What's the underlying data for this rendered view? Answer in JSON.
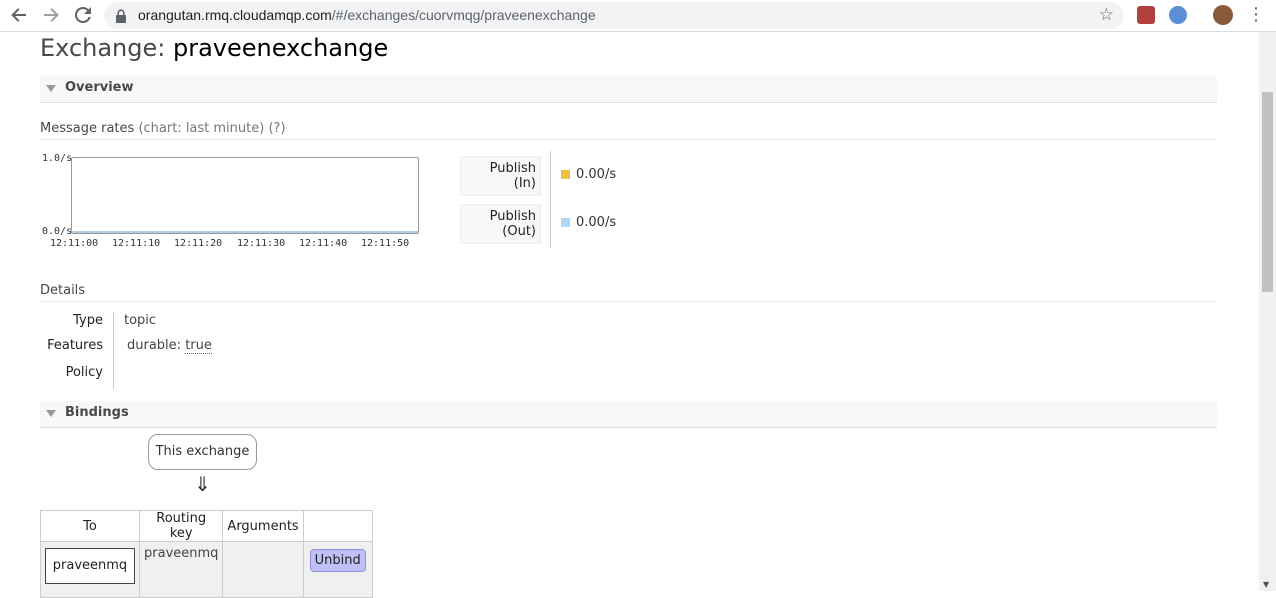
{
  "browser": {
    "url_host": "orangutan.rmq.cloudamqp.com",
    "url_path": "/#/exchanges/cuorvmqg/praveenexchange",
    "back_icon": "back-arrow-icon",
    "forward_icon": "forward-arrow-icon",
    "reload_icon": "reload-icon"
  },
  "page": {
    "title_prefix": "Exchange:",
    "exchange_name": "praveenexchange"
  },
  "overview": {
    "section_label": "Overview",
    "rates_label": "Message rates",
    "rates_hint": "(chart: last minute)",
    "rates_help": "(?)",
    "chart": {
      "y_top": "1.0/s",
      "y_bottom": "0.0/s",
      "x_ticks": [
        "12:11:00",
        "12:11:10",
        "12:11:20",
        "12:11:30",
        "12:11:40",
        "12:11:50"
      ]
    },
    "rates": [
      {
        "label_1": "Publish",
        "label_2": "(In)",
        "value": "0.00/s",
        "color": "#edc240"
      },
      {
        "label_1": "Publish",
        "label_2": "(Out)",
        "value": "0.00/s",
        "color": "#afd8f8"
      }
    ]
  },
  "details": {
    "label": "Details",
    "type_key": "Type",
    "type_value": "topic",
    "features_key": "Features",
    "features_name": "durable:",
    "features_value": "true",
    "policy_key": "Policy"
  },
  "bindings": {
    "section_label": "Bindings",
    "source_label": "This exchange",
    "arrow": "⇓",
    "headers": [
      "To",
      "Routing key",
      "Arguments",
      ""
    ],
    "rows": [
      {
        "to": "praveenmq",
        "routing_key": "praveenmq",
        "arguments": "",
        "action": "Unbind"
      }
    ]
  }
}
